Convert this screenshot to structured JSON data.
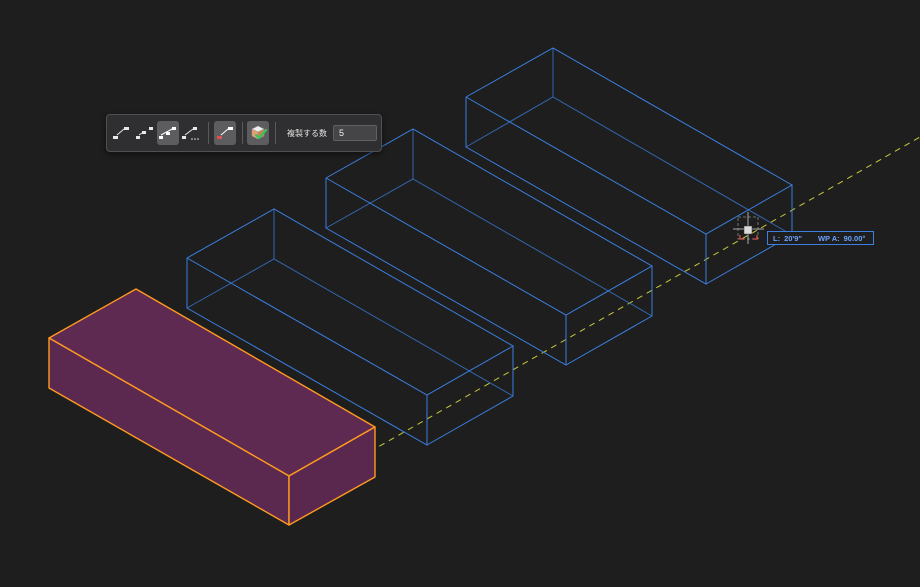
{
  "colors": {
    "background": "#1e1e1e",
    "selected_face": "#5e2a52",
    "selected_edge": "#ff9a1f",
    "ghost_edge": "#3b7fe0",
    "guide_line": "#c8c83a"
  },
  "toolbar": {
    "modes": [
      {
        "icon": "linear-copy-icon",
        "active": false
      },
      {
        "icon": "distributed-copy-icon",
        "active": false
      },
      {
        "icon": "equal-spacing-copy-icon",
        "active": true
      },
      {
        "icon": "continuous-copy-icon",
        "active": false
      }
    ],
    "reference_icon": "reference-point-icon",
    "apply_icon": "apply-check-icon",
    "count_label": "複製する数",
    "count_value": "5"
  },
  "readout": {
    "length_label": "L:",
    "length_value": "20'9\"",
    "angle_label": "WP A:",
    "angle_value": "90.00°"
  }
}
